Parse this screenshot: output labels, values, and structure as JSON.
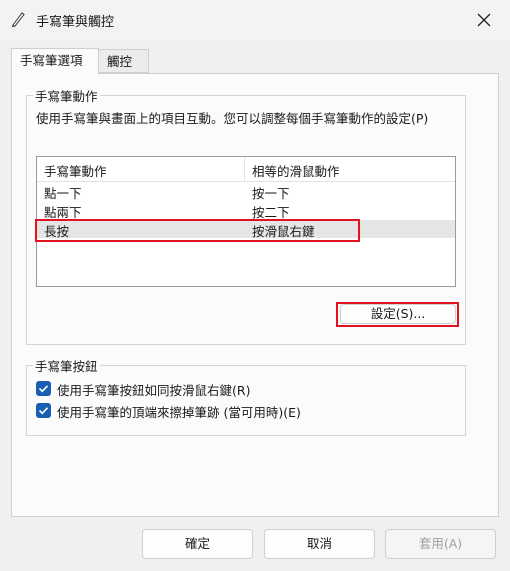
{
  "window": {
    "title": "手寫筆與觸控",
    "close_icon": "close-icon",
    "pen_icon": "pen-icon"
  },
  "tabs": [
    {
      "label": "手寫筆選項"
    },
    {
      "label": "觸控"
    }
  ],
  "pen_actions": {
    "group_label": "手寫筆動作",
    "description": "使用手寫筆與畫面上的項目互動。您可以調整每個手寫筆動作的設定(P)",
    "columns": [
      "手寫筆動作",
      "相等的滑鼠動作"
    ],
    "rows": [
      {
        "action": "點一下",
        "mouse": "按一下"
      },
      {
        "action": "點兩下",
        "mouse": "按二下"
      },
      {
        "action": "長按",
        "mouse": "按滑鼠右鍵"
      }
    ],
    "settings_button": "設定(S)..."
  },
  "pen_buttons": {
    "group_label": "手寫筆按鈕",
    "options": [
      {
        "label": "使用手寫筆按鈕如同按滑鼠右鍵(R)",
        "checked": true
      },
      {
        "label": "使用手寫筆的頂端來擦掉筆跡 (當可用時)(E)",
        "checked": true
      }
    ]
  },
  "footer": {
    "ok": "確定",
    "cancel": "取消",
    "apply": "套用(A)"
  },
  "colors": {
    "accent": "#1a5fb4",
    "highlight": "#e0141e"
  }
}
